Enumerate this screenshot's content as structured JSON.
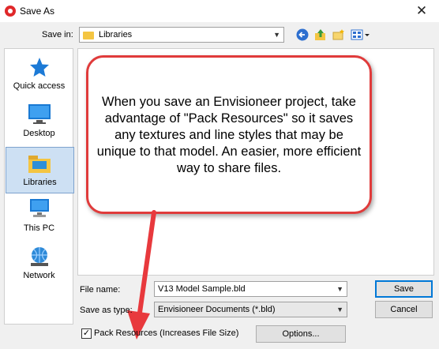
{
  "window": {
    "title": "Save As",
    "close_glyph": "✕"
  },
  "toolbar": {
    "save_in_label": "Save in:",
    "save_in_value": "Libraries",
    "back_icon": "back-arrow-icon",
    "up_icon": "up-folder-icon",
    "new_folder_icon": "new-folder-icon",
    "view_icon": "view-menu-icon"
  },
  "places": [
    {
      "label": "Quick access",
      "icon": "star-icon"
    },
    {
      "label": "Desktop",
      "icon": "desktop-icon"
    },
    {
      "label": "Libraries",
      "icon": "libraries-icon",
      "selected": true
    },
    {
      "label": "This PC",
      "icon": "computer-icon"
    },
    {
      "label": "Network",
      "icon": "network-icon"
    }
  ],
  "callout": {
    "text": "When you save an Envisioneer project, take advantage of \"Pack Resources\" so it saves any textures and line styles that may be unique to that model. An easier, more efficient way to share files.",
    "border_color": "#e03b3b"
  },
  "form": {
    "file_name_label": "File name:",
    "file_name_value": "V13 Model Sample.bld",
    "save_type_label": "Save as type:",
    "save_type_value": "Envisioneer Documents (*.bld)",
    "save_button": "Save",
    "cancel_button": "Cancel",
    "pack_checkbox_label": "Pack Resources (Increases File Size)",
    "pack_checked": true,
    "options_button": "Options..."
  },
  "colors": {
    "accent": "#0078d7",
    "arrow": "#e8393d",
    "selection": "#cde0f3"
  }
}
